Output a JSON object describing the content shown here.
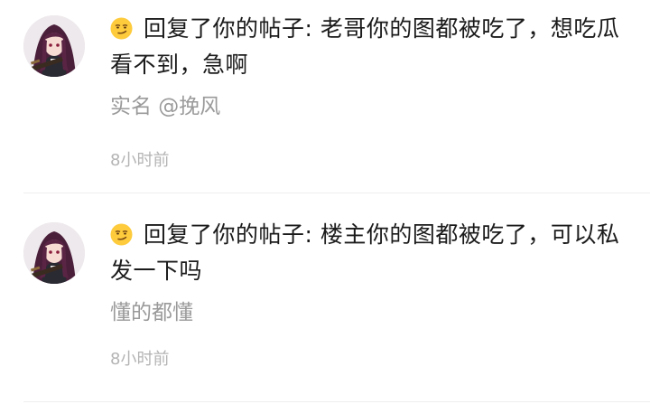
{
  "notifications": [
    {
      "avatar_icon": "anime-girl-avatar",
      "emoji_icon": "smirk-emoji-icon",
      "reply_prefix": "回复了你的帖子: ",
      "reply_text": "老哥你的图都被吃了，想吃瓜看不到，急啊",
      "quote_text": "实名 @挽风",
      "time": "8小时前"
    },
    {
      "avatar_icon": "anime-girl-avatar",
      "emoji_icon": "smirk-emoji-icon",
      "reply_prefix": "回复了你的帖子: ",
      "reply_text": "楼主你的图都被吃了，可以私发一下吗",
      "quote_text": "懂的都懂",
      "time": "8小时前"
    }
  ]
}
